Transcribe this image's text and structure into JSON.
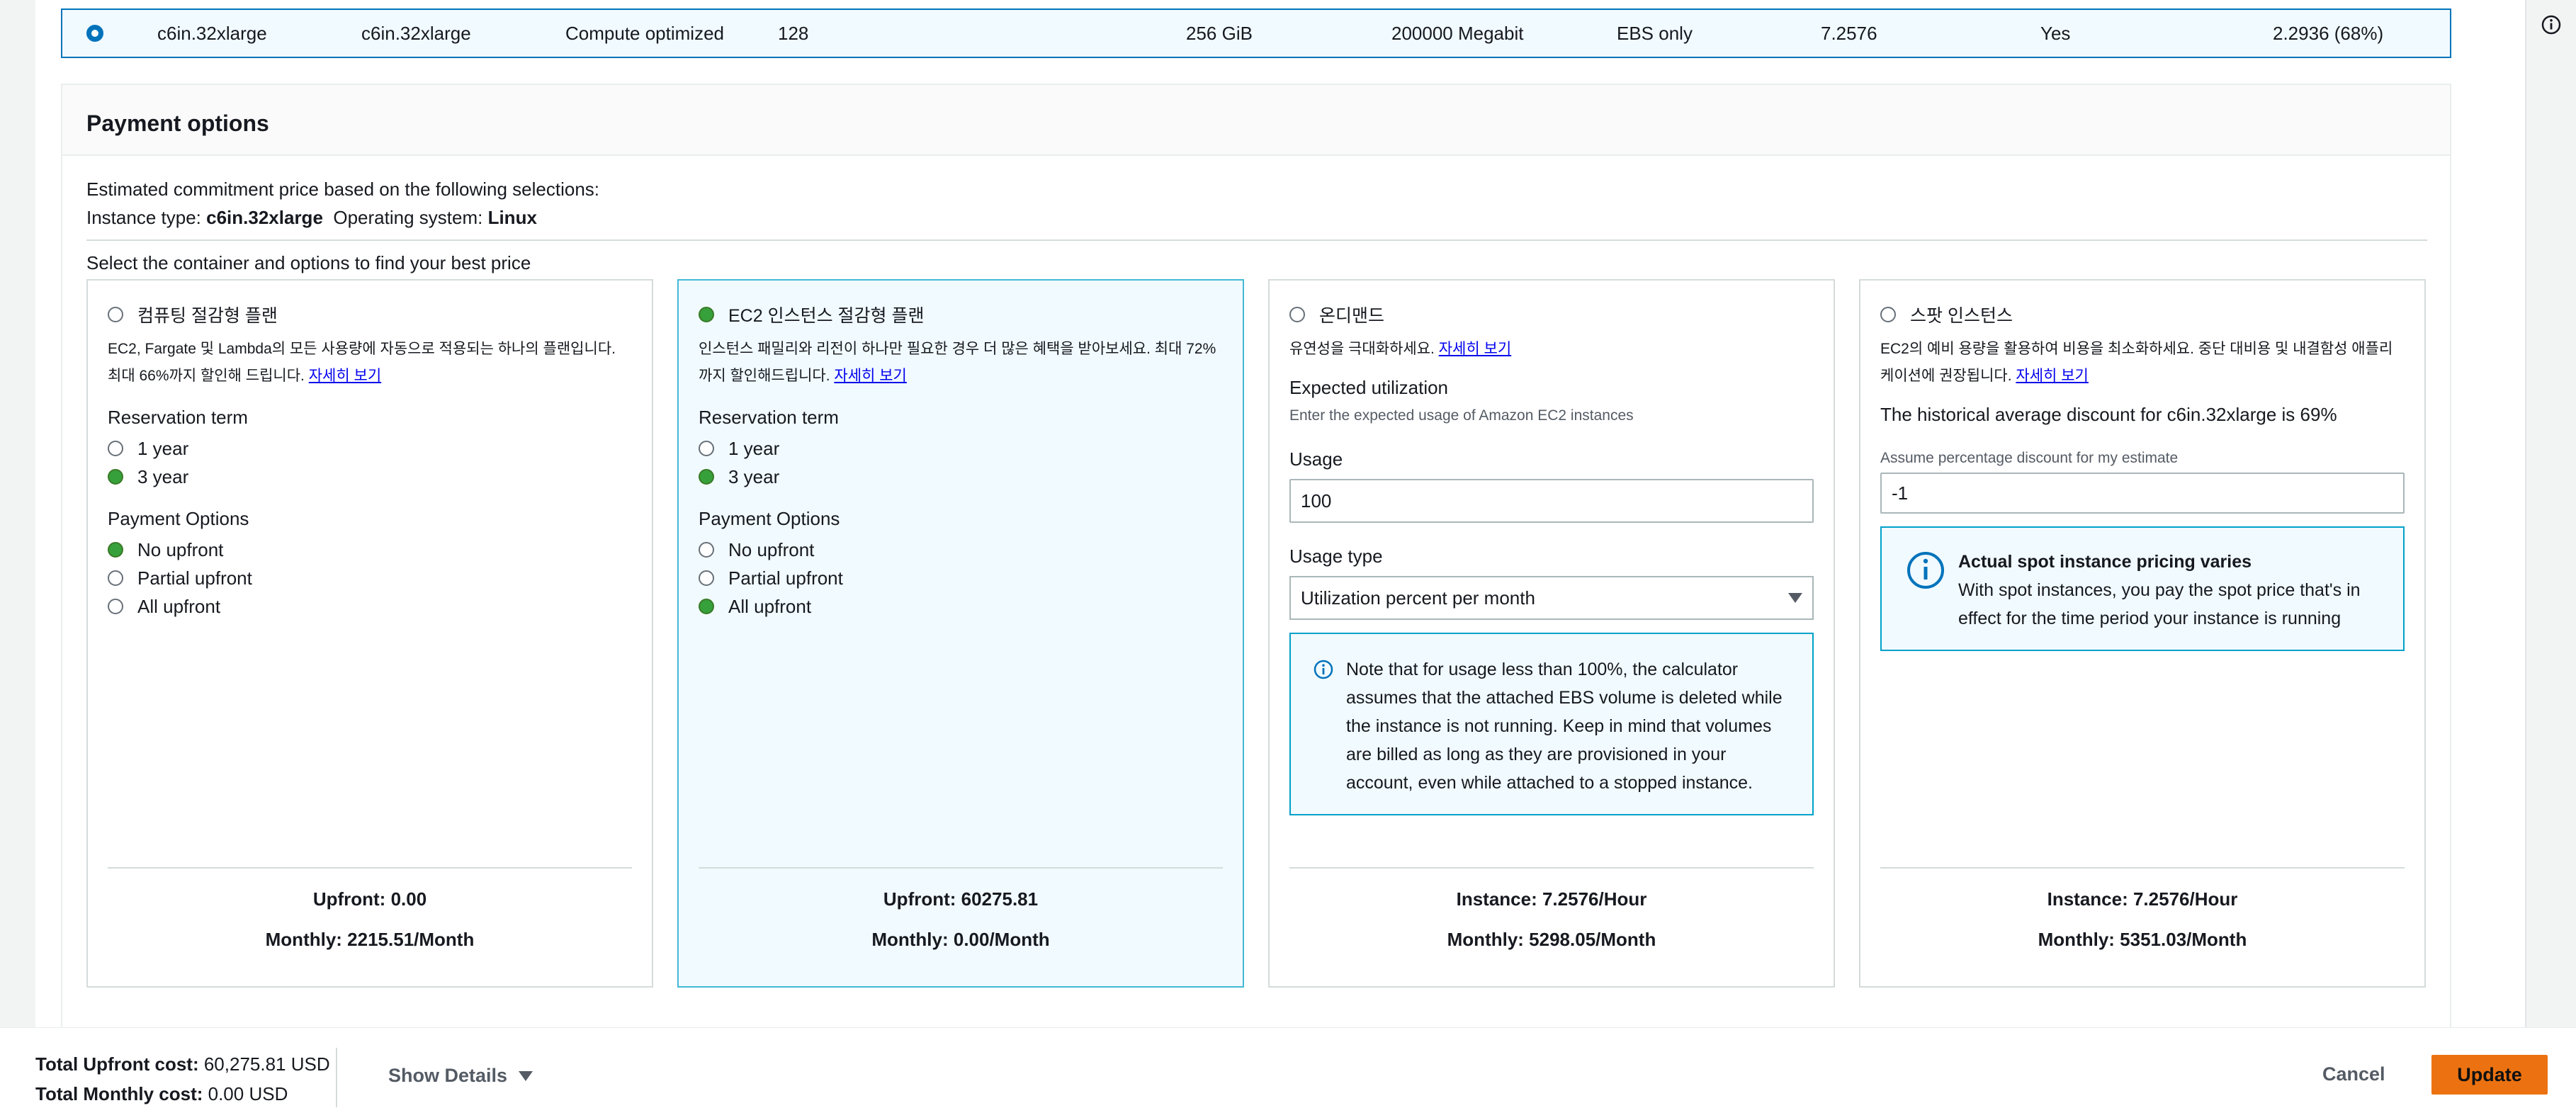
{
  "selected_row": {
    "name": "c6in.32xlarge",
    "api_name": "c6in.32xlarge",
    "family": "Compute optimized",
    "vcpus": "128",
    "memory": "256 GiB",
    "network": "200000 Megabit",
    "storage": "EBS only",
    "on_demand": "7.2576",
    "flag": "Yes",
    "savings": "2.2936 (68%)"
  },
  "payment": {
    "title": "Payment options",
    "estimate_line": "Estimated commitment price based on the following selections:",
    "instance_type_label": "Instance type:",
    "instance_type_value": "c6in.32xlarge",
    "os_label": "Operating system:",
    "os_value": "Linux",
    "select_label": "Select the container and options to find your best price"
  },
  "cards": {
    "compute": {
      "title": "컴퓨팅 절감형 플랜",
      "desc": "EC2, Fargate 및 Lambda의 모든 사용량에 자동으로 적용되는 하나의 플랜입니다. 최대 66%까지 할인해 드립니다.",
      "link": "자세히 보기",
      "term_label": "Reservation term",
      "term_1": "1 year",
      "term_3": "3 year",
      "payment_label": "Payment Options",
      "pay_no": "No upfront",
      "pay_partial": "Partial upfront",
      "pay_all": "All upfront",
      "foot1": "Upfront: 0.00",
      "foot2": "Monthly: 2215.51/Month"
    },
    "ec2": {
      "title": "EC2 인스턴스 절감형 플랜",
      "desc": "인스턴스 패밀리와 리전이 하나만 필요한 경우 더 많은 혜택을 받아보세요. 최대 72%까지 할인해드립니다.",
      "link": "자세히 보기",
      "term_label": "Reservation term",
      "term_1": "1 year",
      "term_3": "3 year",
      "payment_label": "Payment Options",
      "pay_no": "No upfront",
      "pay_partial": "Partial upfront",
      "pay_all": "All upfront",
      "foot1": "Upfront: 60275.81",
      "foot2": "Monthly: 0.00/Month"
    },
    "ondemand": {
      "title": "온디맨드",
      "desc": "유연성을 극대화하세요.",
      "link": "자세히 보기",
      "util_label": "Expected utilization",
      "util_sub": "Enter the expected usage of Amazon EC2 instances",
      "usage_label": "Usage",
      "usage_value": "100",
      "usage_type_label": "Usage type",
      "usage_type_value": "Utilization percent per month",
      "note": "Note that for usage less than 100%, the calculator assumes that the attached EBS volume is deleted while the instance is not running. Keep in mind that volumes are billed as long as they are provisioned in your account, even while attached to a stopped instance.",
      "foot1": "Instance: 7.2576/Hour",
      "foot2": "Monthly: 5298.05/Month"
    },
    "spot": {
      "title": "스팟 인스턴스",
      "desc": "EC2의 예비 용량을 활용하여 비용을 최소화하세요. 중단 대비용 및 내결함성 애플리케이션에 권장됩니다.",
      "link": "자세히 보기",
      "historical": "The historical average discount for c6in.32xlarge is 69%",
      "assume_label": "Assume percentage discount for my estimate",
      "assume_value": "-1",
      "alert_title": "Actual spot instance pricing varies",
      "alert_body": "With spot instances, you pay the spot price that's in effect for the time period your instance is running",
      "foot1": "Instance: 7.2576/Hour",
      "foot2": "Monthly: 5351.03/Month"
    }
  },
  "footer": {
    "upfront_label": "Total Upfront cost:",
    "upfront_value": "60,275.81 USD",
    "monthly_label": "Total Monthly cost:",
    "monthly_value": "0.00 USD",
    "show_details": "Show Details",
    "cancel": "Cancel",
    "update": "Update"
  },
  "icons": {
    "info": "info-icon",
    "caret": "caret-down-icon"
  },
  "colors": {
    "primary_blue": "#0073bb",
    "selected_green": "#1d8102",
    "info_border": "#00a1c9",
    "update_orange": "#ec7211"
  }
}
